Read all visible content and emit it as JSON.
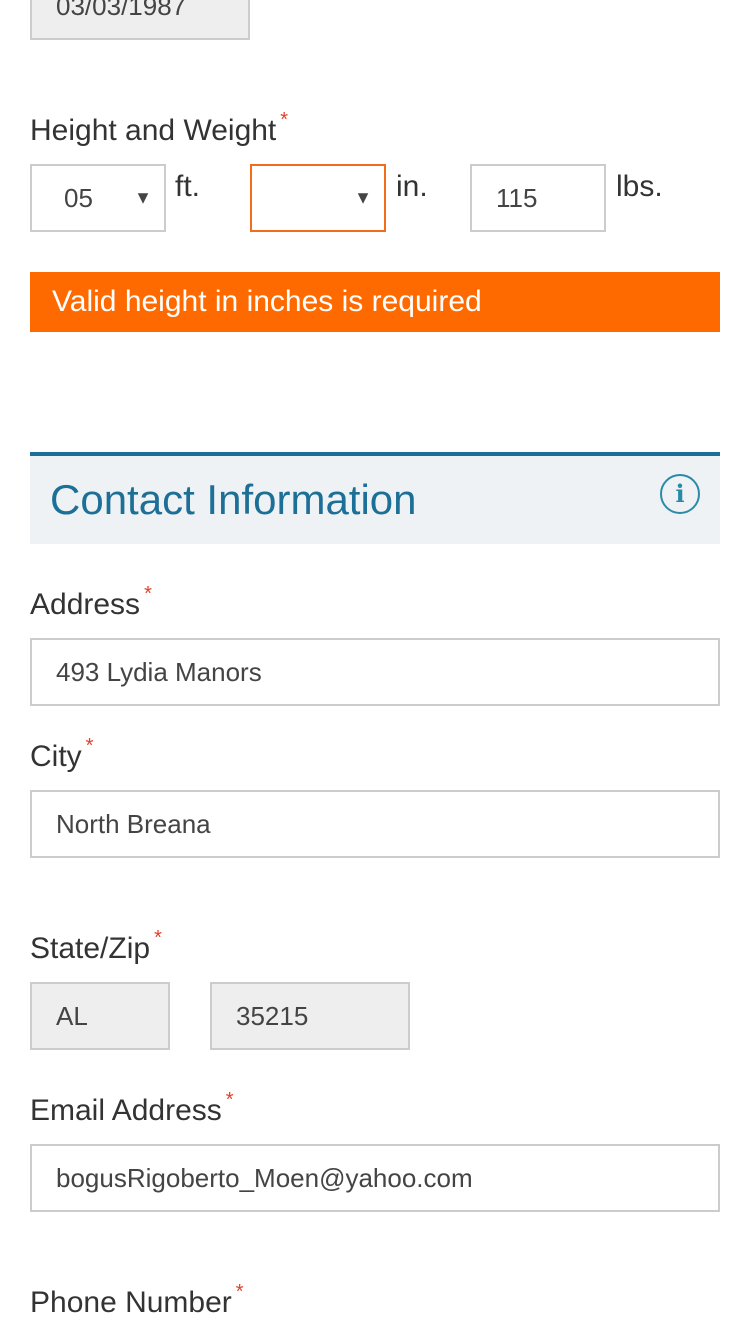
{
  "dob": {
    "value": "03/03/1987"
  },
  "height_weight": {
    "label": "Height and Weight",
    "required_mark": "*",
    "feet": {
      "value": "05",
      "unit": "ft."
    },
    "inches": {
      "value": "",
      "unit": "in."
    },
    "weight": {
      "value": "115",
      "unit": "lbs."
    },
    "error": "Valid height in inches is required"
  },
  "contact_section": {
    "title": "Contact Information",
    "info_icon": "info-icon"
  },
  "address": {
    "label": "Address",
    "required_mark": "*",
    "value": "493 Lydia Manors"
  },
  "city": {
    "label": "City",
    "required_mark": "*",
    "value": "North Breana"
  },
  "state_zip": {
    "label": "State/Zip",
    "required_mark": "*",
    "state": "AL",
    "zip": "35215"
  },
  "email": {
    "label": "Email Address",
    "required_mark": "*",
    "value": "bogusRigoberto_Moen@yahoo.com"
  },
  "phone": {
    "label": "Phone Number",
    "required_mark": "*"
  },
  "colors": {
    "error": "#ff6a00",
    "accent": "#1c6f96",
    "required": "#e0402a"
  }
}
